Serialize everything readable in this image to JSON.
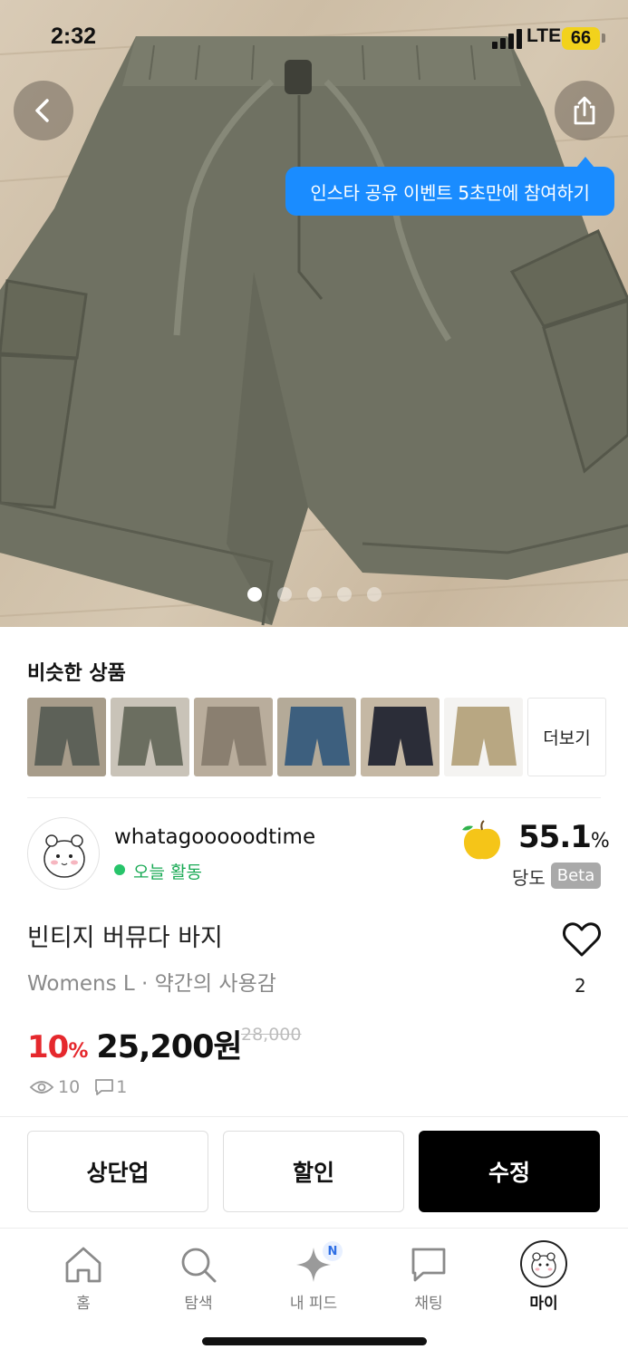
{
  "status_bar": {
    "time": "2:32",
    "network": "LTE",
    "battery": "66"
  },
  "hero": {
    "tooltip": "인스타 공유 이벤트 5초만에 참여하기",
    "image_count": 5,
    "active_image": 1
  },
  "similar": {
    "title": "비슷한 상품",
    "more_label": "더보기",
    "thumbnail_colors": [
      "#5d6158",
      "#6b6e60",
      "#8a7f70",
      "#3d5f7e",
      "#2b2d38",
      "#b8a782"
    ]
  },
  "seller": {
    "name": "whatagooooodtime",
    "activity": "오늘 활동",
    "sweetness_value": "55.1",
    "sweetness_unit": "%",
    "sweetness_label": "당도",
    "beta_label": "Beta"
  },
  "product": {
    "title": "빈티지 버뮤다 바지",
    "subtitle": "Womens L · 약간의 사용감",
    "likes": "2",
    "discount": "10",
    "discount_unit": "%",
    "price": "25,200원",
    "original_price": "28,000",
    "views": "10",
    "comments": "1"
  },
  "actions": {
    "bump": "상단업",
    "discount": "할인",
    "edit": "수정"
  },
  "tabbar": {
    "home": "홈",
    "search": "탐색",
    "feed": "내 피드",
    "feed_badge": "N",
    "chat": "채팅",
    "my": "마이"
  },
  "colors": {
    "accent_red": "#e5282d",
    "tooltip_blue": "#1a8cff",
    "active_green": "#27c46a",
    "shorts_olive": "#6f7162"
  }
}
